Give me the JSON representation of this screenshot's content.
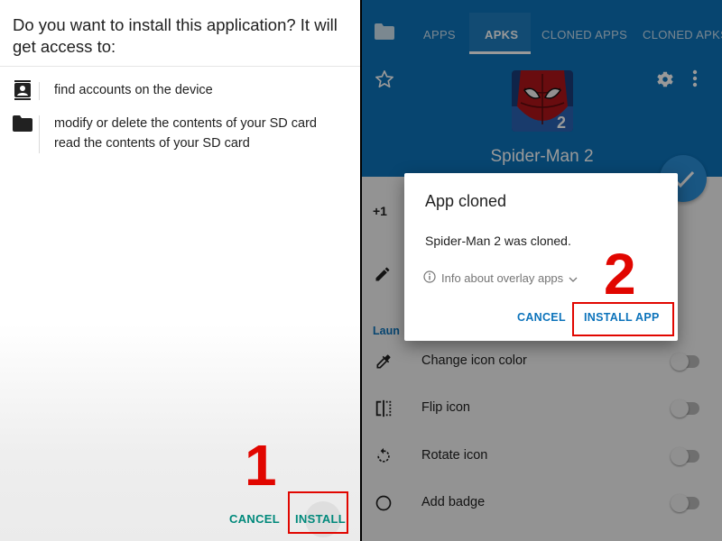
{
  "left": {
    "title": "Do you want to install this application? It will get access to:",
    "permissions": [
      {
        "icon": "contacts-icon",
        "lines": [
          "find accounts on the device"
        ]
      },
      {
        "icon": "folder-icon",
        "lines": [
          "modify or delete the contents of your SD card",
          "read the contents of your SD card"
        ]
      }
    ],
    "cancel_label": "CANCEL",
    "install_label": "INSTALL",
    "step_number": "1"
  },
  "right": {
    "tabs": [
      "APPS",
      "APKS",
      "CLONED APPS",
      "CLONED APKS"
    ],
    "active_tab": "APKS",
    "app_name": "Spider-Man 2",
    "plus_label": "+1",
    "section_label": "Laun",
    "options": [
      {
        "label": "Change icon color",
        "icon": "eyedropper-icon"
      },
      {
        "label": "Flip icon",
        "icon": "flip-icon"
      },
      {
        "label": "Rotate icon",
        "icon": "rotate-icon"
      },
      {
        "label": "Add badge",
        "icon": "circle-icon"
      }
    ],
    "dialog": {
      "title": "App cloned",
      "message": "Spider-Man 2 was cloned.",
      "info": "Info about overlay apps",
      "cancel_label": "CANCEL",
      "install_label": "INSTALL APP"
    },
    "step_number": "2"
  },
  "colors": {
    "accent_teal": "#00897b",
    "appbar_blue": "#0c73bb",
    "highlight_red": "#e10600"
  }
}
